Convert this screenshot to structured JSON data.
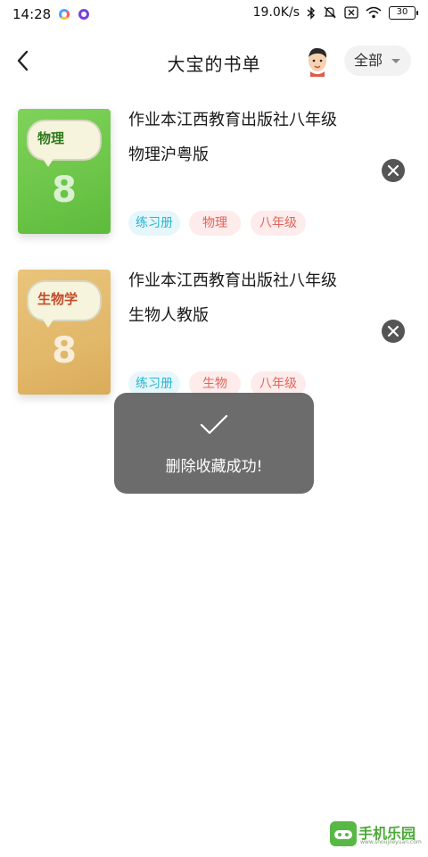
{
  "status_bar": {
    "time": "14:28",
    "network_speed": "19.0K/s",
    "battery": "30"
  },
  "header": {
    "title": "大宝的书单",
    "filter_label": "全部"
  },
  "books": [
    {
      "title_line1": "作业本江西教育出版社八年级",
      "title_line2": "物理沪粤版",
      "cover_subject": "物理",
      "cover_number": "8",
      "tags": [
        "练习册",
        "物理",
        "八年级"
      ]
    },
    {
      "title_line1": "作业本江西教育出版社八年级",
      "title_line2": "生物人教版",
      "cover_subject": "生物学",
      "cover_number": "8",
      "tags": [
        "练习册",
        "生物",
        "八年级"
      ]
    }
  ],
  "toast": {
    "message": "删除收藏成功!"
  },
  "watermark": {
    "text": "手机乐园",
    "sub": "www.shoujileyuan.com"
  },
  "colors": {
    "tag_type": "#2bb5d0",
    "tag_subject": "#e2645a",
    "toast_bg": "#606060"
  }
}
